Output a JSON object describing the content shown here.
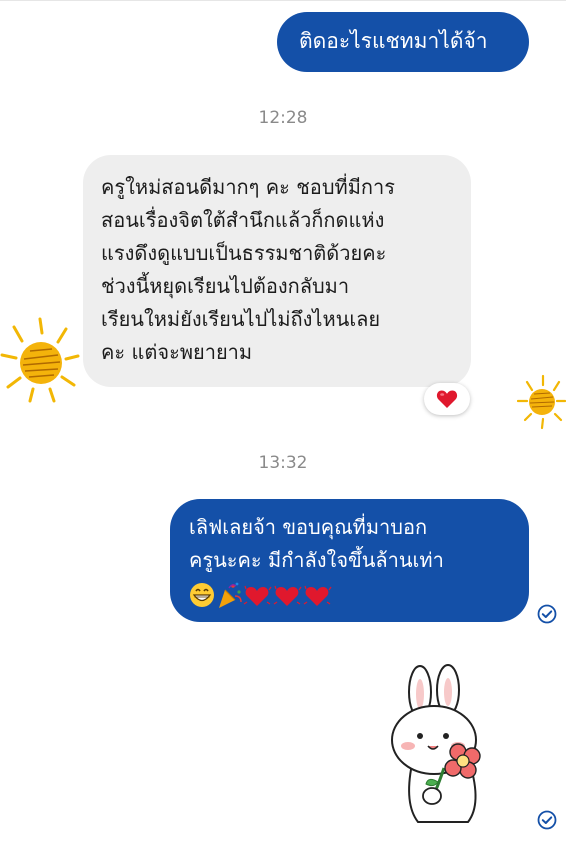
{
  "messages": [
    {
      "direction": "outgoing",
      "text": "ติดอะไรแชทมาได้จ้า"
    },
    {
      "timestamp": "12:28"
    },
    {
      "direction": "incoming",
      "lines": [
        "ครูใหม่สอนดีมากๆ คะ ชอบที่มีการ",
        "สอนเรื่องจิตใต้สำนึกแล้วก็กดแห่ง",
        "แรงดึงดูแบบเป็นธรรมชาติด้วยคะ",
        "ช่วงนี้หยุดเรียนไปต้องกลับมา",
        "เรียนใหม่ยังเรียนไปไม่ถึงไหนเลย",
        "คะ แต่จะพยายาม"
      ],
      "reaction": "heart"
    },
    {
      "timestamp": "13:32"
    },
    {
      "direction": "outgoing",
      "lines": [
        "เลิฟเลยจ้า ขอบคุณที่มาบอก",
        "ครูนะคะ มีกำลังใจขึ้นล้านเท่า"
      ],
      "emojis": [
        "grinning-face",
        "party-popper",
        "sparkling-heart",
        "sparkling-heart",
        "sparkling-heart"
      ],
      "status": "delivered"
    },
    {
      "direction": "outgoing",
      "sticker": "bunny-with-flower",
      "status": "delivered"
    }
  ],
  "colors": {
    "outgoing_bubble": "#1450a8",
    "incoming_bubble": "#eeeeee",
    "timestamp": "#8a8a8a",
    "status_check": "#1450a8"
  }
}
